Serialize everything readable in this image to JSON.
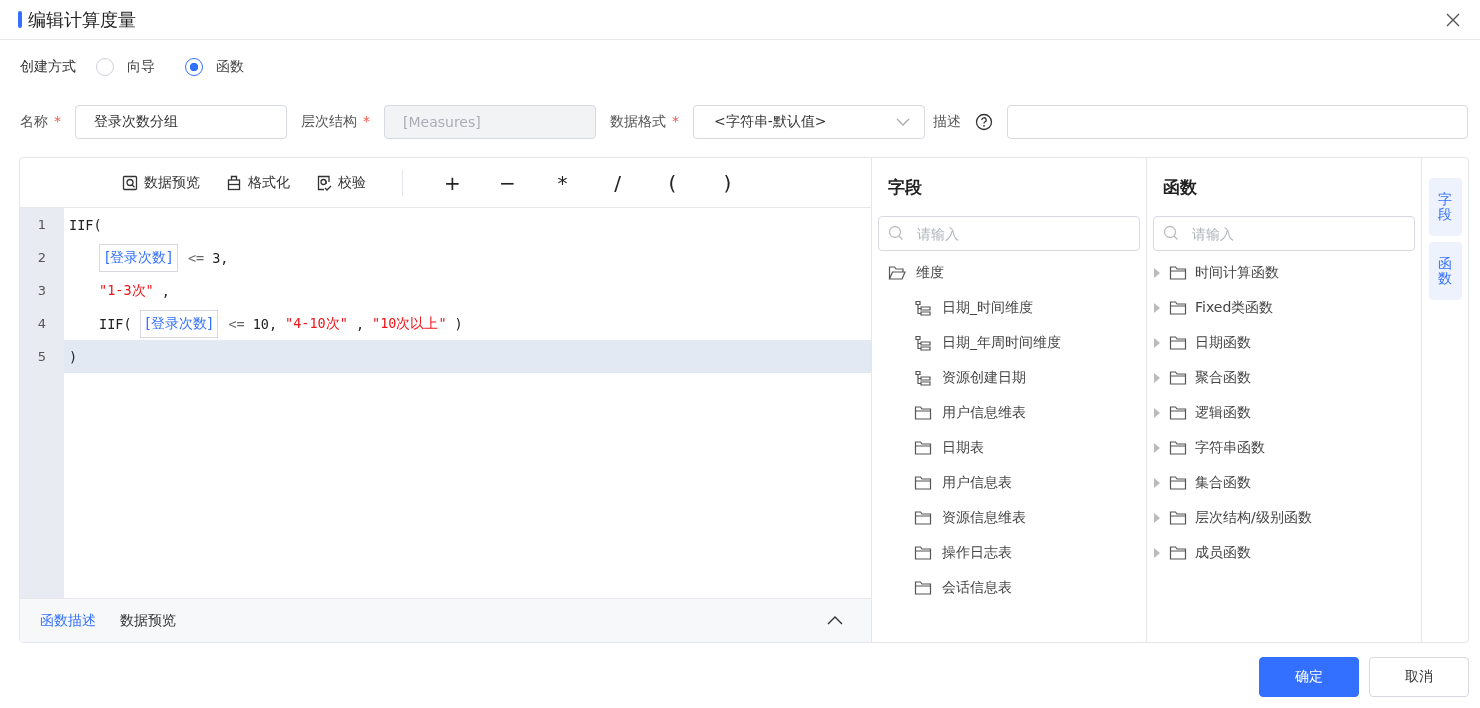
{
  "dialog": {
    "title": "编辑计算度量"
  },
  "create_mode": {
    "label": "创建方式",
    "options": [
      {
        "label": "向导",
        "selected": false
      },
      {
        "label": "函数",
        "selected": true
      }
    ]
  },
  "form": [
    {
      "label": "名称",
      "required": true,
      "kind": "input",
      "value": "登录次数分组",
      "disabled": false
    },
    {
      "label": "层次结构",
      "required": true,
      "kind": "input",
      "value": "[Measures]",
      "disabled": true
    },
    {
      "label": "数据格式",
      "required": true,
      "kind": "select",
      "value": "<字符串-默认值>",
      "disabled": false
    },
    {
      "label": "描述",
      "required": false,
      "kind": "input",
      "disabled": false,
      "help": true
    }
  ],
  "toolbar": [
    {
      "kind": "preview",
      "label": "数据预览"
    },
    {
      "kind": "format",
      "label": "格式化"
    },
    {
      "kind": "check",
      "label": "校验"
    }
  ],
  "operators": [
    "+",
    "−",
    "*",
    "/",
    "(",
    ")"
  ],
  "code_lines": [
    {
      "number": "1",
      "indented": false,
      "selected": false,
      "tokens": [
        {
          "kind": "plain",
          "text": "IIF("
        }
      ]
    },
    {
      "number": "2",
      "indented": true,
      "selected": false,
      "tokens": [
        {
          "kind": "field",
          "text": "[登录次数]"
        },
        {
          "kind": "op",
          "text": "<="
        },
        {
          "kind": "plain",
          "text": "3,"
        }
      ]
    },
    {
      "number": "3",
      "indented": true,
      "selected": false,
      "tokens": [
        {
          "kind": "string",
          "text": "\"1-3次\""
        },
        {
          "kind": "plain",
          "text": ","
        }
      ]
    },
    {
      "number": "4",
      "indented": true,
      "selected": false,
      "tokens": [
        {
          "kind": "plain",
          "text": "IIF("
        },
        {
          "kind": "field",
          "text": "[登录次数]"
        },
        {
          "kind": "op",
          "text": "<="
        },
        {
          "kind": "plain",
          "text": "10,"
        },
        {
          "kind": "string",
          "text": "\"4-10次\""
        },
        {
          "kind": "plain",
          "text": ","
        },
        {
          "kind": "string",
          "text": "\"10次以上\""
        },
        {
          "kind": "plain",
          "text": ")"
        }
      ]
    },
    {
      "number": "5",
      "indented": false,
      "selected": true,
      "tokens": [
        {
          "kind": "plain",
          "text": ")"
        }
      ]
    }
  ],
  "bottom_tabs": [
    {
      "label": "函数描述",
      "selected": true
    },
    {
      "label": "数据预览",
      "selected": false
    }
  ],
  "fields_panel": {
    "title": "字段",
    "search": {
      "placeholder": "请输入"
    },
    "tree": [
      {
        "label": "维度",
        "kind": "folder",
        "expanded": true,
        "children": [
          {
            "label": "日期_时间维度",
            "kind": "hierarchy"
          },
          {
            "label": "日期_年周时间维度",
            "kind": "hierarchy"
          },
          {
            "label": "资源创建日期",
            "kind": "hierarchy"
          },
          {
            "label": "用户信息维表",
            "kind": "folder",
            "expanded": false
          },
          {
            "label": "日期表",
            "kind": "folder",
            "expanded": false
          },
          {
            "label": "用户信息表",
            "kind": "folder",
            "expanded": false
          },
          {
            "label": "资源信息维表",
            "kind": "folder",
            "expanded": false
          },
          {
            "label": "操作日志表",
            "kind": "folder",
            "expanded": false
          },
          {
            "label": "会话信息表",
            "kind": "folder",
            "expanded": false
          }
        ]
      }
    ]
  },
  "functions_panel": {
    "title": "函数",
    "search": {
      "placeholder": "请输入"
    },
    "items": [
      {
        "label": "时间计算函数",
        "expanded": false
      },
      {
        "label": "Fixed类函数",
        "expanded": false
      },
      {
        "label": "日期函数",
        "expanded": false
      },
      {
        "label": "聚合函数",
        "expanded": false
      },
      {
        "label": "逻辑函数",
        "expanded": false
      },
      {
        "label": "字符串函数",
        "expanded": false
      },
      {
        "label": "集合函数",
        "expanded": false
      },
      {
        "label": "层次结构/级别函数",
        "expanded": false
      },
      {
        "label": "成员函数",
        "expanded": false
      }
    ]
  },
  "side_tabs": [
    {
      "label": "字段",
      "selected": false
    },
    {
      "label": "函数",
      "selected": false
    }
  ],
  "buttons": [
    {
      "kind": "primary",
      "label": "确定"
    },
    {
      "kind": "default",
      "label": "取消"
    }
  ]
}
